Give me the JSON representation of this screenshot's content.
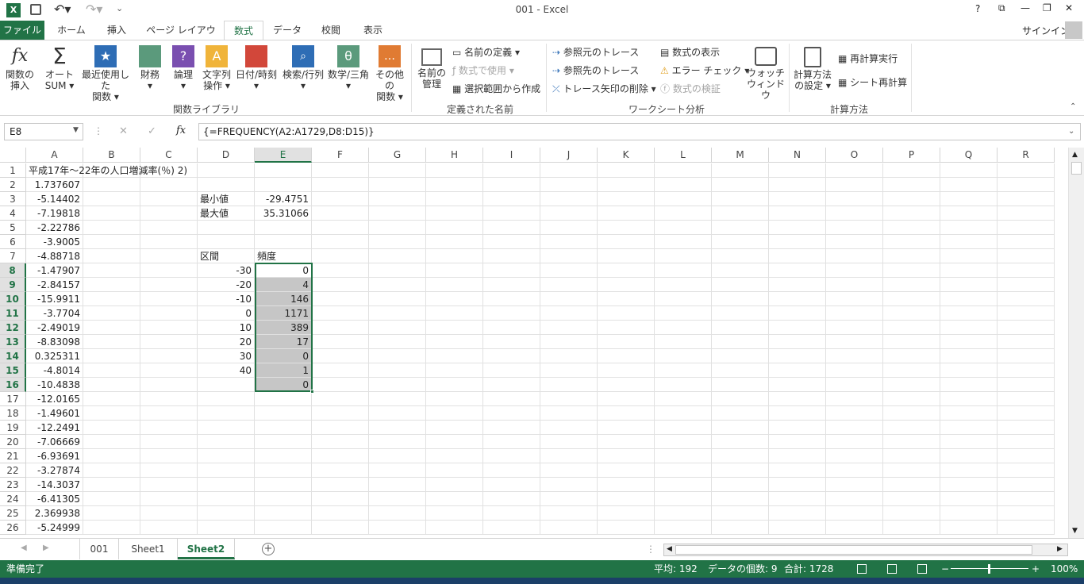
{
  "window": {
    "title": "001 - Excel",
    "controls": [
      "?",
      "⧉",
      "—",
      "❐",
      "✕"
    ]
  },
  "qat": {
    "save_icon": "save-icon",
    "undo_icon": "undo-icon",
    "redo_icon": "redo-icon"
  },
  "tabs": [
    "ファイル",
    "ホーム",
    "挿入",
    "ページ レイアウト",
    "数式",
    "データ",
    "校閲",
    "表示"
  ],
  "signin": "サインイン",
  "ribbon": {
    "group1": {
      "label": "関数ライブラリ",
      "buttons": [
        {
          "l1": "関数の",
          "l2": "挿入"
        },
        {
          "l1": "オート",
          "l2": "SUM ▾"
        },
        {
          "l1": "最近使用した",
          "l2": "関数 ▾"
        },
        {
          "l1": "財務",
          "l2": "▾"
        },
        {
          "l1": "論理",
          "l2": "▾"
        },
        {
          "l1": "文字列",
          "l2": "操作 ▾"
        },
        {
          "l1": "日付/時刻",
          "l2": "▾"
        },
        {
          "l1": "検索/行列",
          "l2": "▾"
        },
        {
          "l1": "数学/三角",
          "l2": "▾"
        },
        {
          "l1": "その他の",
          "l2": "関数 ▾"
        }
      ]
    },
    "group2": {
      "label": "定義された名前",
      "manage_l1": "名前の",
      "manage_l2": "管理",
      "define": "名前の定義  ▾",
      "use": "数式で使用 ▾",
      "create": "選択範囲から作成"
    },
    "group3": {
      "label": "ワークシート分析",
      "trace_prec": "参照元のトレース",
      "trace_dep": "参照先のトレース",
      "remove_arrows": "トレース矢印の削除  ▾",
      "show_formulas": "数式の表示",
      "error_check": "エラー チェック  ▾",
      "evaluate": "数式の検証",
      "watch_l1": "ウォッチ",
      "watch_l2": "ウィンドウ"
    },
    "group4": {
      "label": "計算方法",
      "options_l1": "計算方法",
      "options_l2": "の設定 ▾",
      "calc_now": "再計算実行",
      "calc_sheet": "シート再計算"
    }
  },
  "formula_bar": {
    "name_box": "E8",
    "formula": "{=FREQUENCY(A2:A1729,D8:D15)}",
    "cancel": "✕",
    "enter": "✓",
    "fx": "fx"
  },
  "columns": [
    "A",
    "B",
    "C",
    "D",
    "E",
    "F",
    "G",
    "H",
    "I",
    "J",
    "K",
    "L",
    "M",
    "N",
    "O",
    "P",
    "Q",
    "R"
  ],
  "rows": [
    {
      "n": "1",
      "A": "平成17年～22年の人口増減率(％) 2)",
      "D": "",
      "E": ""
    },
    {
      "n": "2",
      "A": "1.737607",
      "D": "",
      "E": ""
    },
    {
      "n": "3",
      "A": "-5.14402",
      "D": "最小値",
      "E": "-29.4751"
    },
    {
      "n": "4",
      "A": "-7.19818",
      "D": "最大値",
      "E": "35.31066"
    },
    {
      "n": "5",
      "A": "-2.22786",
      "D": "",
      "E": ""
    },
    {
      "n": "6",
      "A": "-3.9005",
      "D": "",
      "E": ""
    },
    {
      "n": "7",
      "A": "-4.88718",
      "D": "区間",
      "E": "頻度"
    },
    {
      "n": "8",
      "A": "-1.47907",
      "D": "-30",
      "E": "0"
    },
    {
      "n": "9",
      "A": "-2.84157",
      "D": "-20",
      "E": "4"
    },
    {
      "n": "10",
      "A": "-15.9911",
      "D": "-10",
      "E": "146"
    },
    {
      "n": "11",
      "A": "-3.7704",
      "D": "0",
      "E": "1171"
    },
    {
      "n": "12",
      "A": "-2.49019",
      "D": "10",
      "E": "389"
    },
    {
      "n": "13",
      "A": "-8.83098",
      "D": "20",
      "E": "17"
    },
    {
      "n": "14",
      "A": "0.325311",
      "D": "30",
      "E": "0"
    },
    {
      "n": "15",
      "A": "-4.8014",
      "D": "40",
      "E": "1"
    },
    {
      "n": "16",
      "A": "-10.4838",
      "D": "",
      "E": "0"
    },
    {
      "n": "17",
      "A": "-12.0165",
      "D": "",
      "E": ""
    },
    {
      "n": "18",
      "A": "-1.49601",
      "D": "",
      "E": ""
    },
    {
      "n": "19",
      "A": "-12.2491",
      "D": "",
      "E": ""
    },
    {
      "n": "20",
      "A": "-7.06669",
      "D": "",
      "E": ""
    },
    {
      "n": "21",
      "A": "-6.93691",
      "D": "",
      "E": ""
    },
    {
      "n": "22",
      "A": "-3.27874",
      "D": "",
      "E": ""
    },
    {
      "n": "23",
      "A": "-14.3037",
      "D": "",
      "E": ""
    },
    {
      "n": "24",
      "A": "-6.41305",
      "D": "",
      "E": ""
    },
    {
      "n": "25",
      "A": "2.369938",
      "D": "",
      "E": ""
    },
    {
      "n": "26",
      "A": "-5.24999",
      "D": "",
      "E": ""
    }
  ],
  "sheets": [
    "001",
    "Sheet1",
    "Sheet2"
  ],
  "active_sheet": "Sheet2",
  "status": {
    "ready": "準備完了",
    "average": "平均: 192",
    "count": "データの個数: 9",
    "sum": "合計: 1728",
    "zoom": "100%"
  },
  "colors": {
    "accent": "#217346",
    "selection": "#c6c6c6"
  }
}
